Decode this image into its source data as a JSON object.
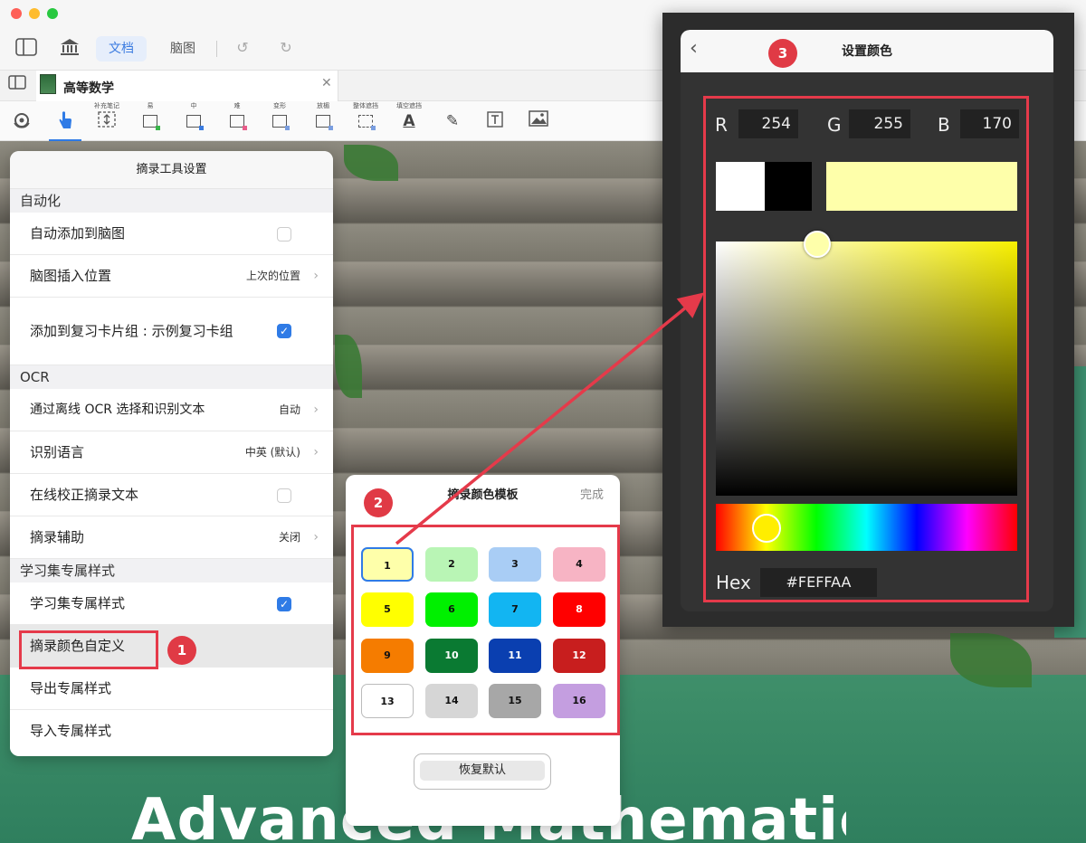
{
  "window": {
    "seg_doc": "文档",
    "seg_mindmap": "脑图"
  },
  "tab": {
    "title": "高等数学"
  },
  "toolbar": {
    "tools": [
      {
        "label": "",
        "icon": "settings-icon"
      },
      {
        "label": "",
        "icon": "hand-pointer-icon"
      },
      {
        "label": "补充笔记",
        "icon": "supplement-note-icon"
      },
      {
        "label": "易",
        "icon": "box-easy-icon",
        "dot": "#39b54a"
      },
      {
        "label": "中",
        "icon": "box-medium-icon",
        "dot": "#3a7be0"
      },
      {
        "label": "难",
        "icon": "box-hard-icon",
        "dot": "#e85d8a"
      },
      {
        "label": "变形",
        "icon": "box-transform-icon",
        "dot": "#7a9ee0"
      },
      {
        "label": "放楣",
        "icon": "box-fangmei-icon",
        "dot": "#7a9ee0"
      },
      {
        "label": "整体遮挡",
        "icon": "box-mask-icon",
        "dot": "#7a9ee0"
      },
      {
        "label": "填空遮挡",
        "icon": "text-mask-icon"
      },
      {
        "label": "",
        "icon": "pen-icon"
      },
      {
        "label": "",
        "icon": "textbox-icon"
      },
      {
        "label": "",
        "icon": "image-icon"
      }
    ]
  },
  "background": {
    "title": "Advanced Mathematics"
  },
  "settings": {
    "title": "摘录工具设置",
    "sections": {
      "automation": "自动化",
      "ocr": "OCR",
      "study": "学习集专属样式"
    },
    "rows": {
      "auto_add": "自动添加到脑图",
      "insert_pos": "脑图插入位置",
      "insert_pos_val": "上次的位置",
      "add_review": "添加到复习卡片组 : 示例复习卡组",
      "offline_ocr": "通过离线 OCR 选择和识别文本",
      "offline_ocr_val": "自动",
      "lang": "识别语言",
      "lang_val": "中英 (默认)",
      "online_correct": "在线校正摘录文本",
      "assist": "摘录辅助",
      "assist_val": "关闭",
      "study_style": "学习集专属样式",
      "custom_color": "摘录颜色自定义",
      "export_style": "导出专属样式",
      "import_style": "导入专属样式"
    }
  },
  "template": {
    "title": "摘录颜色模板",
    "done": "完成",
    "restore": "恢复默认",
    "swatches": [
      {
        "label": "1",
        "color": "#FEFFAA",
        "text": "#111"
      },
      {
        "label": "2",
        "color": "#b9f5b5",
        "text": "#111"
      },
      {
        "label": "3",
        "color": "#a9cdf5",
        "text": "#111"
      },
      {
        "label": "4",
        "color": "#f7b4c4",
        "text": "#111"
      },
      {
        "label": "5",
        "color": "#ffff00",
        "text": "#111"
      },
      {
        "label": "6",
        "color": "#00f000",
        "text": "#111"
      },
      {
        "label": "7",
        "color": "#12b5f2",
        "text": "#111"
      },
      {
        "label": "8",
        "color": "#ff0000",
        "text": "#fff"
      },
      {
        "label": "9",
        "color": "#f57c00",
        "text": "#111"
      },
      {
        "label": "10",
        "color": "#0a7a32",
        "text": "#fff"
      },
      {
        "label": "11",
        "color": "#0a3fb0",
        "text": "#fff"
      },
      {
        "label": "12",
        "color": "#c81e1e",
        "text": "#fff"
      },
      {
        "label": "13",
        "color": "#ffffff",
        "text": "#111"
      },
      {
        "label": "14",
        "color": "#d6d6d6",
        "text": "#111"
      },
      {
        "label": "15",
        "color": "#a7a7a7",
        "text": "#111"
      },
      {
        "label": "16",
        "color": "#c49ee0",
        "text": "#111"
      }
    ]
  },
  "picker": {
    "title": "设置颜色",
    "r_label": "R",
    "r": "254",
    "g_label": "G",
    "g": "255",
    "b_label": "B",
    "b": "170",
    "hex_label": "Hex",
    "hex": "#FEFFAA",
    "current_color": "#FEFFAA"
  },
  "badges": [
    "1",
    "2",
    "3"
  ]
}
